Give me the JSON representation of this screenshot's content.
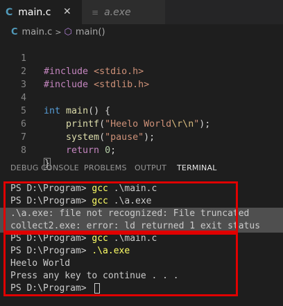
{
  "tabs": [
    {
      "icon": "C",
      "label": "main.c",
      "close": "✕"
    },
    {
      "icon": "≡",
      "label": "a.exe"
    }
  ],
  "breadcrumb": {
    "icon": "C",
    "file": "main.c",
    "sep": ">",
    "symbol": "main()"
  },
  "editor": {
    "line_numbers": [
      "1",
      "2",
      "3",
      "4",
      "5",
      "6",
      "7",
      "8"
    ],
    "lines": [
      {
        "kw": "#include",
        "str": "<stdio.h>"
      },
      {
        "kw": "#include",
        "str": "<stdlib.h>"
      },
      {},
      {
        "type": "int",
        "fn": "main",
        "rest": "() {"
      },
      {
        "fn": "printf",
        "open": "(",
        "str1": "\"Heelo World",
        "esc": "\\r\\n",
        "str2": "\"",
        "close": ");"
      },
      {
        "fn": "system",
        "open": "(",
        "str": "\"pause\"",
        "close": ");"
      },
      {
        "kw": "return",
        "num": "0",
        "close": ";"
      },
      {
        "brace": "}"
      }
    ]
  },
  "panel_tabs": [
    "DEBUG CONSOLE",
    "PROBLEMS",
    "OUTPUT",
    "TERMINAL"
  ],
  "terminal": {
    "lines": [
      {
        "prompt": "PS D:\\Program> ",
        "cmd": "gcc",
        "args": " .\\main.c"
      },
      {
        "prompt": "PS D:\\Program> ",
        "cmd": "gcc",
        "args": " .\\a.exe"
      },
      {
        "text": ".\\a.exe: file not recognized: File truncated"
      },
      {
        "text": "collect2.exe: error: ld returned 1 exit status"
      },
      {
        "prompt": "PS D:\\Program> ",
        "cmd": "gcc",
        "args": " .\\main.c"
      },
      {
        "prompt": "PS D:\\Program> ",
        "cmd": ".\\a.exe",
        "args": ""
      },
      {
        "text": "Heelo World"
      },
      {
        "text": "Press any key to continue . . ."
      },
      {
        "prompt": "PS D:\\Program> "
      }
    ]
  },
  "colors": {
    "annotation_box": "#e00000",
    "accent": "#519aba"
  }
}
